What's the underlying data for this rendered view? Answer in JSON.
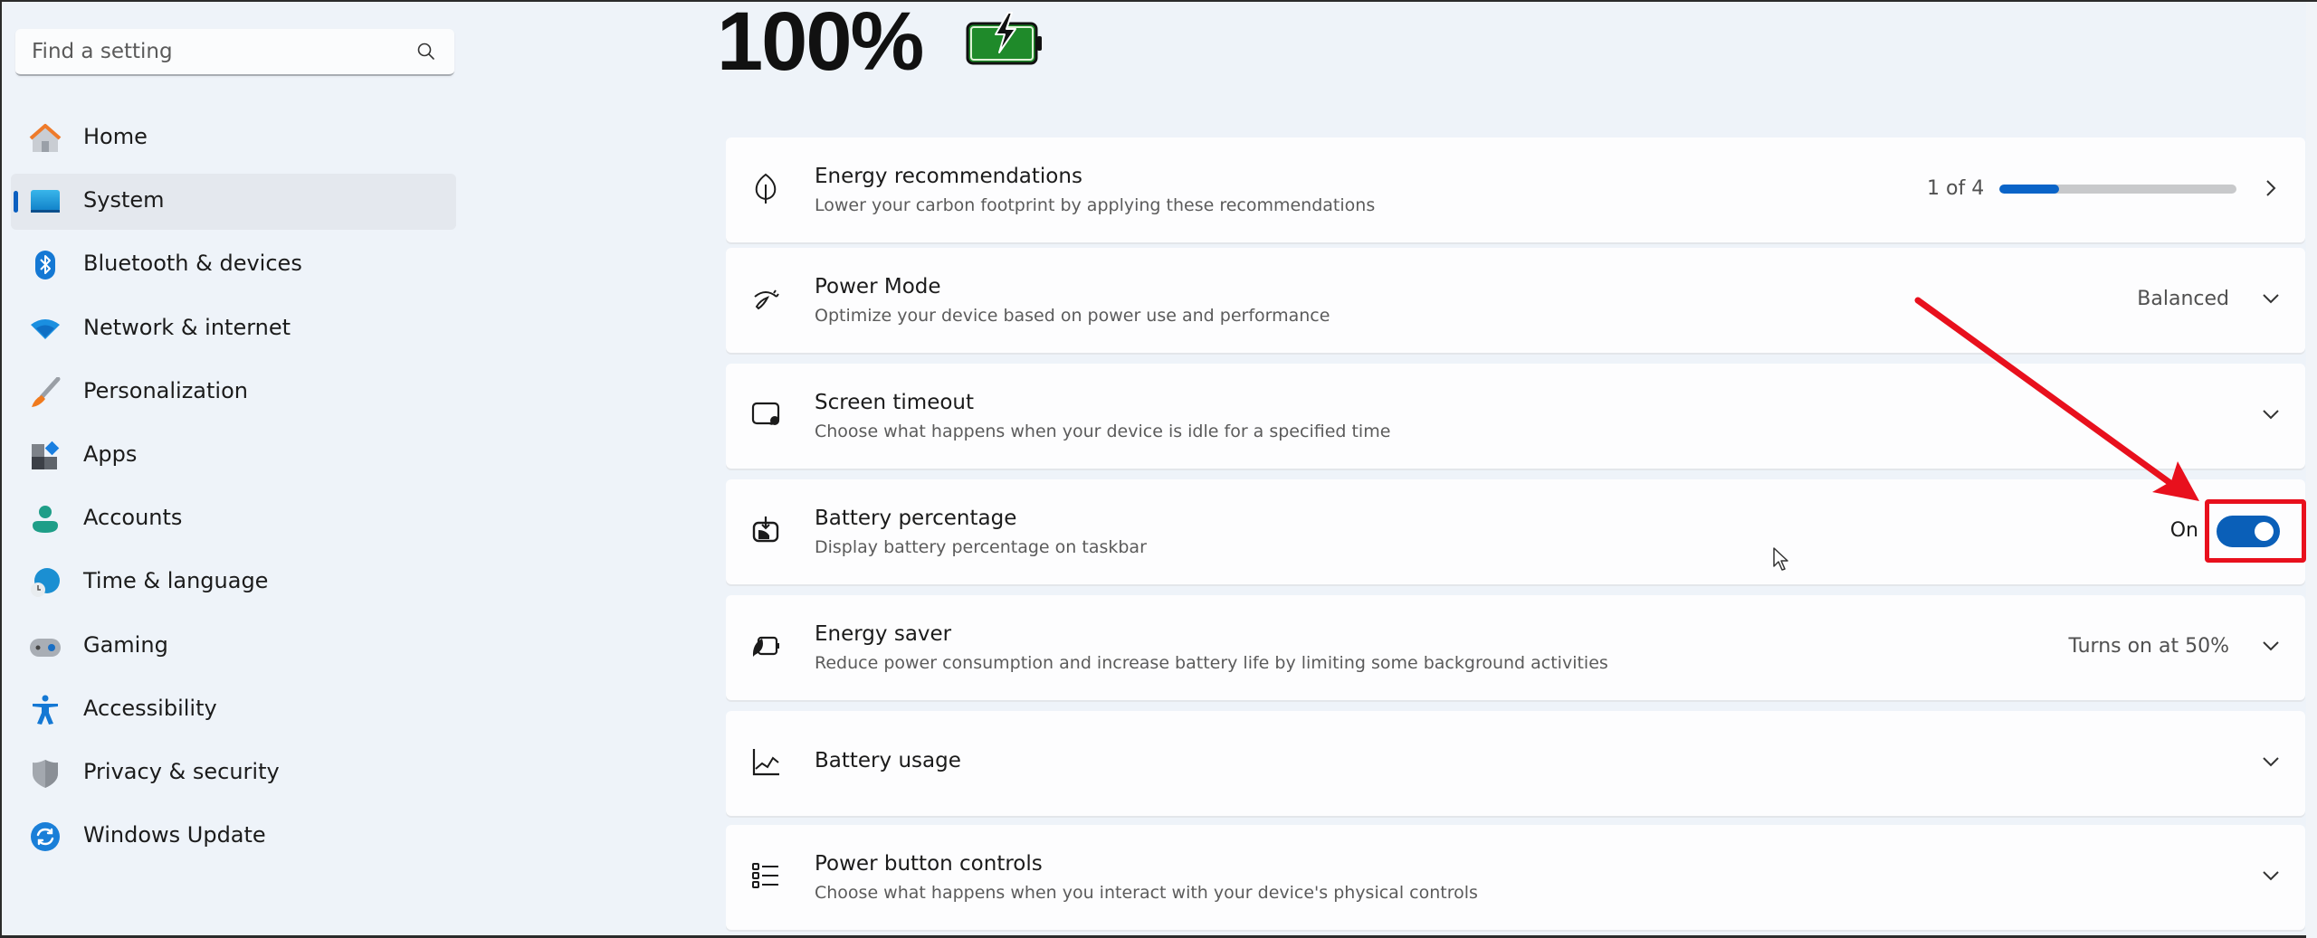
{
  "sidebar": {
    "search": {
      "placeholder": "Find a setting",
      "value": ""
    },
    "items": [
      {
        "label": "Home",
        "icon": "home-icon",
        "active": false
      },
      {
        "label": "System",
        "icon": "system-icon",
        "active": true
      },
      {
        "label": "Bluetooth & devices",
        "icon": "bluetooth-icon",
        "active": false
      },
      {
        "label": "Network & internet",
        "icon": "wifi-icon",
        "active": false
      },
      {
        "label": "Personalization",
        "icon": "paintbrush-icon",
        "active": false
      },
      {
        "label": "Apps",
        "icon": "apps-icon",
        "active": false
      },
      {
        "label": "Accounts",
        "icon": "account-icon",
        "active": false
      },
      {
        "label": "Time & language",
        "icon": "time-language-icon",
        "active": false
      },
      {
        "label": "Gaming",
        "icon": "gamepad-icon",
        "active": false
      },
      {
        "label": "Accessibility",
        "icon": "accessibility-icon",
        "active": false
      },
      {
        "label": "Privacy & security",
        "icon": "shield-icon",
        "active": false
      },
      {
        "label": "Windows Update",
        "icon": "windows-update-icon",
        "active": false
      }
    ]
  },
  "battery": {
    "percentage": "100%",
    "state": "charging",
    "icon": "battery-charging-icon",
    "color": "#1f8a2a"
  },
  "settings": {
    "energy_recommendations": {
      "title": "Energy recommendations",
      "description": "Lower your carbon footprint by applying these recommendations",
      "progress_text": "1 of 4",
      "progress_fraction": 0.25,
      "icon": "leaf-icon"
    },
    "power_mode": {
      "title": "Power Mode",
      "description": "Optimize your device based on power use and performance",
      "value": "Balanced",
      "icon": "gauge-icon"
    },
    "screen_timeout": {
      "title": "Screen timeout",
      "description": "Choose what happens when your device is idle for a specified time",
      "icon": "screen-timeout-icon"
    },
    "battery_percentage": {
      "title": "Battery percentage",
      "description": "Display battery percentage on taskbar",
      "toggle_label": "On",
      "toggle_on": true,
      "icon": "battery-percentage-icon"
    },
    "energy_saver": {
      "title": "Energy saver",
      "description": "Reduce power consumption and increase battery life by limiting some background activities",
      "value": "Turns on at 50%",
      "icon": "energy-saver-icon"
    },
    "battery_usage": {
      "title": "Battery usage",
      "icon": "chart-icon"
    },
    "power_button_controls": {
      "title": "Power button controls",
      "description": "Choose what happens when you interact with your device's physical controls",
      "icon": "list-icon"
    }
  },
  "colors": {
    "accent": "#0a5fb8",
    "annotation": "#e8101d"
  }
}
